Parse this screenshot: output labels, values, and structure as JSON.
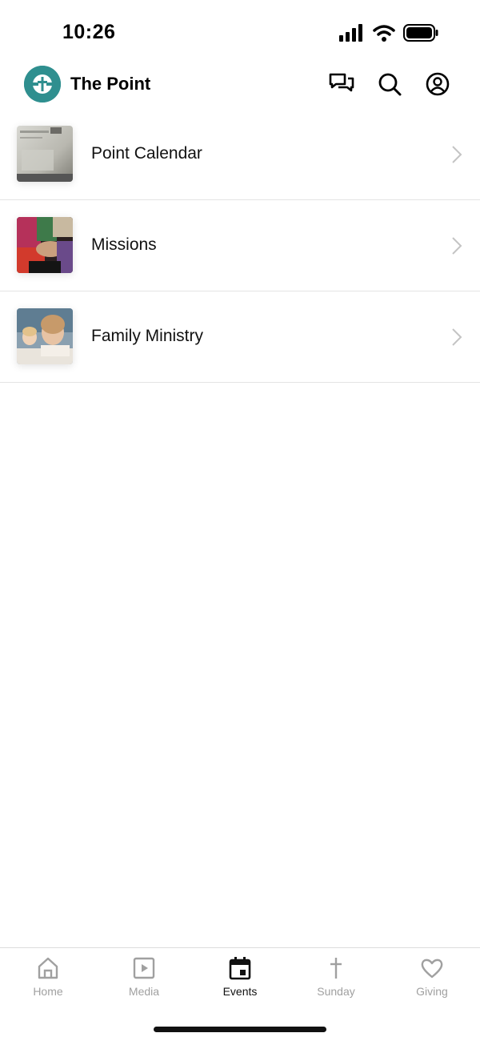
{
  "status_bar": {
    "time": "10:26",
    "icons": [
      "cellular-signal-icon",
      "wifi-icon",
      "battery-icon"
    ]
  },
  "header": {
    "title": "The Point",
    "logo_color": "#2f8f8f",
    "actions": [
      "chat-icon",
      "search-icon",
      "profile-icon"
    ]
  },
  "events": {
    "items": [
      {
        "label": "Point Calendar",
        "thumbnail": "calendar-photo"
      },
      {
        "label": "Missions",
        "thumbnail": "missions-photo"
      },
      {
        "label": "Family Ministry",
        "thumbnail": "family-ministry-photo"
      }
    ]
  },
  "tabs": {
    "active": "Events",
    "items": [
      {
        "label": "Home",
        "icon": "home-icon"
      },
      {
        "label": "Media",
        "icon": "media-play-icon"
      },
      {
        "label": "Events",
        "icon": "calendar-icon"
      },
      {
        "label": "Sunday",
        "icon": "cross-icon"
      },
      {
        "label": "Giving",
        "icon": "heart-icon"
      }
    ]
  },
  "colors": {
    "accent": "#2f8f8f",
    "inactive_tab": "#a0a0a0",
    "divider": "#e4e4e4"
  }
}
